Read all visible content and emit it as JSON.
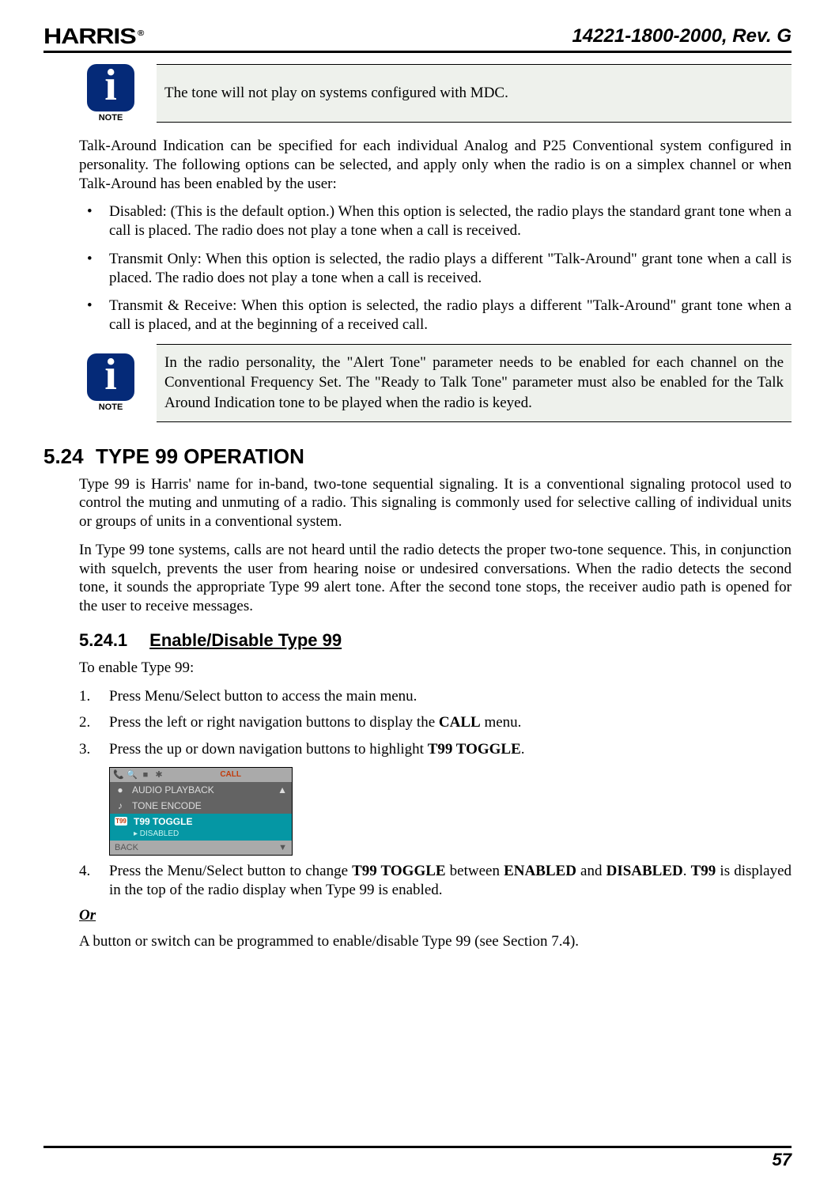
{
  "header": {
    "logo_text": "HARRIS",
    "logo_tm": "®",
    "doc_number": "14221-1800-2000, Rev. G"
  },
  "note1": {
    "caption": "NOTE",
    "text": "The tone will not play on systems configured with MDC."
  },
  "para1": "Talk-Around Indication can be specified for each individual Analog and P25 Conventional system configured in personality.  The following options can be selected, and apply only when the radio is on a simplex channel or when Talk-Around has been enabled by the user:",
  "bullets": [
    "Disabled: (This is the default option.)  When this option is selected, the radio plays the standard grant tone when a call is placed.  The radio does not play a tone when a call is received.",
    "Transmit Only: When this option is selected, the radio plays a different \"Talk-Around\" grant tone when a call is placed.  The radio does not play a tone when a call is received.",
    "Transmit & Receive: When this option is selected, the radio plays a different \"Talk-Around\" grant tone when a call is placed, and at the beginning of a received call."
  ],
  "note2": {
    "caption": "NOTE",
    "text": "In the radio personality, the \"Alert Tone\" parameter needs to be enabled for each channel on the Conventional Frequency Set.  The \"Ready to Talk Tone\" parameter must also be enabled for the Talk Around Indication tone to be played when the radio is keyed."
  },
  "section": {
    "num": "5.24",
    "title": "TYPE 99 OPERATION"
  },
  "para2": "Type 99 is Harris' name for in-band, two-tone sequential signaling. It is a conventional signaling protocol used to control the muting and unmuting of a radio. This signaling is commonly used for selective calling of individual units or groups of units in a conventional system.",
  "para3": "In Type 99 tone systems, calls are not heard until the radio detects the proper two-tone sequence. This, in conjunction with squelch, prevents the user from hearing noise or undesired conversations. When the radio detects the second tone, it sounds the appropriate Type 99 alert tone. After the second tone stops, the receiver audio path is opened for the user to receive messages.",
  "subsection": {
    "num": "5.24.1",
    "title": "Enable/Disable Type 99"
  },
  "para4": "To enable Type 99:",
  "steps": {
    "s1": "Press Menu/Select button to access the main menu.",
    "s2_a": "Press the left or right navigation buttons to display the ",
    "s2_b": "CALL",
    "s2_c": " menu.",
    "s3_a": "Press the up or down navigation buttons to highlight ",
    "s3_b": "T99 TOGGLE",
    "s3_c": ".",
    "s4_a": "Press the Menu/Select button to change ",
    "s4_b": "T99 TOGGLE",
    "s4_c": " between ",
    "s4_d": "ENABLED",
    "s4_e": " and ",
    "s4_f": "DISABLED",
    "s4_g": ". ",
    "s4_h": "T99",
    "s4_i": " is displayed in the top of the radio display when Type 99 is enabled."
  },
  "menu": {
    "tab": "CALL",
    "row1": "AUDIO PLAYBACK",
    "row2": "TONE ENCODE",
    "row3": "T99 TOGGLE",
    "row3_sub": "▸ DISABLED",
    "bottom": "BACK",
    "badge": "T99"
  },
  "or_label": "Or",
  "para5": "A button or switch can be programmed to enable/disable Type 99 (see Section 7.4).",
  "page_number": "57"
}
